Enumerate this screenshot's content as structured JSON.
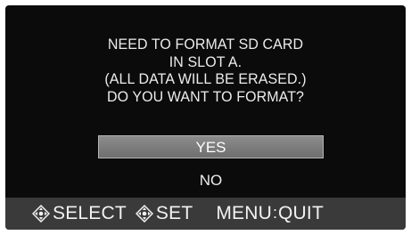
{
  "dialog": {
    "message_lines": [
      "NEED TO FORMAT SD CARD",
      "IN SLOT A.",
      "(ALL DATA WILL BE ERASED.)",
      "DO YOU WANT TO FORMAT?"
    ],
    "options": [
      {
        "label": "YES",
        "selected": true
      },
      {
        "label": "NO",
        "selected": false
      }
    ]
  },
  "footer": {
    "select_label": "SELECT",
    "set_label": "SET",
    "menu_key": "MENU",
    "separator": ":",
    "quit_label": "QUIT",
    "select_icon": "dpad-icon",
    "set_icon": "dpad-icon"
  },
  "colors": {
    "background": "#0b0b0b",
    "selected_option": "#7d7d7d",
    "footer_bar": "#3a3a3a",
    "text": "#ececec"
  }
}
